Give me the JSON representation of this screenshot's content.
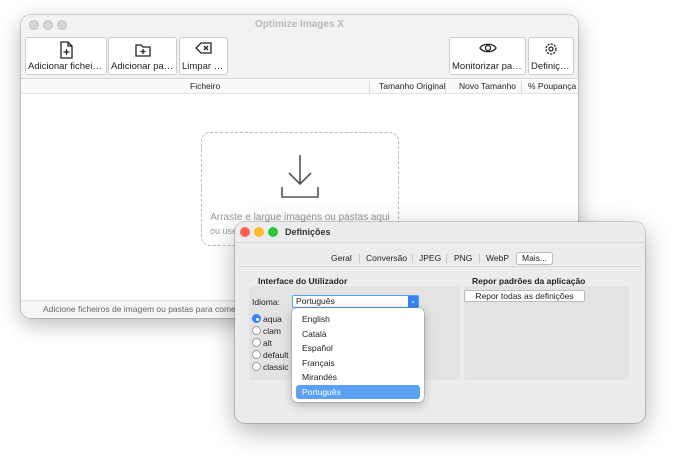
{
  "main_window": {
    "title": "Optimize Images X",
    "toolbar": {
      "add_files": "Adicionar ficheiros...",
      "add_folders": "Adicionar pasta...",
      "clear": "Limpar lista",
      "monitor": "Monitorizar pasta...",
      "settings": "Definições"
    },
    "columns": [
      "Ficheiro",
      "Tamanho Original",
      "Novo Tamanho",
      "% Poupança"
    ],
    "drop_text": "Arraste e largue imagens ou pastas aqui",
    "drop_text_2": "ou use",
    "status": "Adicione ficheiros de imagem ou pastas para começ"
  },
  "settings_window": {
    "title": "Definições",
    "tabs": [
      "Geral",
      "Conversão",
      "JPEG",
      "PNG",
      "WebP",
      "Mais..."
    ],
    "active_tab": "Mais...",
    "ui_section": {
      "title": "Interface do Utilizador",
      "language_label": "Idioma:",
      "language_value": "Português",
      "themes": [
        "aqua",
        "clam",
        "alt",
        "default",
        "classic"
      ],
      "selected_theme": "aqua"
    },
    "reset_section": {
      "title": "Repor padrões da aplicação",
      "button": "Repor todas as definições"
    },
    "language_options": [
      "English",
      "Català",
      "Español",
      "Français",
      "Mirandés",
      "Português"
    ],
    "selected_language": "Português"
  },
  "colors": {
    "accent": "#3b82f6",
    "highlight": "#5aa0f5"
  }
}
